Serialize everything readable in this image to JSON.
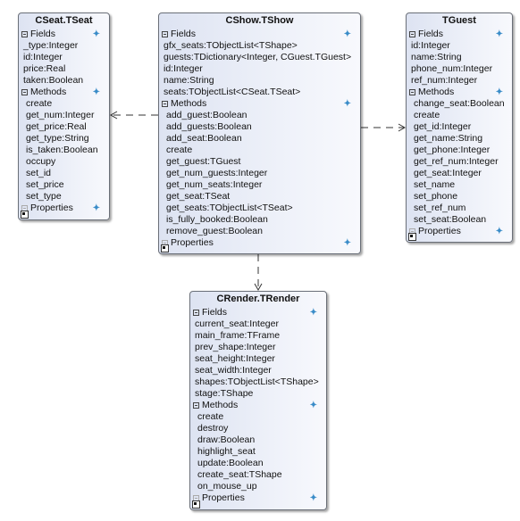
{
  "classes": [
    {
      "id": "cseat",
      "title": "CSeat.TSeat",
      "fields_label": "Fields",
      "methods_label": "Methods",
      "properties_label": "Properties",
      "fields": [
        "_type:Integer",
        "id:Integer",
        "price:Real",
        "taken:Boolean"
      ],
      "methods": [
        "create",
        "get_num:Integer",
        "get_price:Real",
        "get_type:String",
        "is_taken:Boolean",
        "occupy",
        "set_id",
        "set_price",
        "set_type"
      ]
    },
    {
      "id": "cshow",
      "title": "CShow.TShow",
      "fields_label": "Fields",
      "methods_label": "Methods",
      "properties_label": "Properties",
      "fields": [
        "gfx_seats:TObjectList<TShape>",
        "guests:TDictionary<Integer, CGuest.TGuest>",
        "id:Integer",
        "name:String",
        "seats:TObjectList<CSeat.TSeat>"
      ],
      "methods": [
        "add_guest:Boolean",
        "add_guests:Boolean",
        "add_seat:Boolean",
        "create",
        "get_guest:TGuest",
        "get_num_guests:Integer",
        "get_num_seats:Integer",
        "get_seat:TSeat",
        "get_seats:TObjectList<TSeat>",
        "is_fully_booked:Boolean",
        "remove_guest:Boolean"
      ]
    },
    {
      "id": "tguest",
      "title": "TGuest",
      "fields_label": "Fields",
      "methods_label": "Methods",
      "properties_label": "Properties",
      "fields": [
        "id:Integer",
        "name:String",
        "phone_num:Integer",
        "ref_num:Integer"
      ],
      "methods": [
        "change_seat:Boolean",
        "create",
        "get_id:Integer",
        "get_name:String",
        "get_phone:Integer",
        "get_ref_num:Integer",
        "get_seat:Integer",
        "set_name",
        "set_phone",
        "set_ref_num",
        "set_seat:Boolean"
      ]
    },
    {
      "id": "crender",
      "title": "CRender.TRender",
      "fields_label": "Fields",
      "methods_label": "Methods",
      "properties_label": "Properties",
      "fields": [
        "current_seat:Integer",
        "main_frame:TFrame",
        "prev_shape:Integer",
        "seat_height:Integer",
        "seat_width:Integer",
        "shapes:TObjectList<TShape>",
        "stage:TShape"
      ],
      "methods": [
        "create",
        "destroy",
        "draw:Boolean",
        "highlight_seat",
        "update:Boolean",
        "create_seat:TShape",
        "on_mouse_up"
      ]
    }
  ],
  "dependencies": [
    {
      "from": "CShow.TShow",
      "to": "CSeat.TSeat"
    },
    {
      "from": "CShow.TShow",
      "to": "TGuest"
    },
    {
      "from": "CShow.TShow",
      "to": "CRender.TRender"
    }
  ],
  "colors": {
    "plus": "#3a8cc8",
    "border": "#6a6f78",
    "gradient_start": "#dde3f2"
  }
}
